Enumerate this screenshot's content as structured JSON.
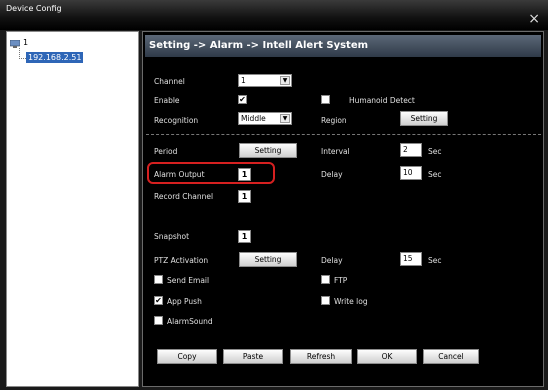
{
  "window": {
    "title": "Device Config",
    "close_glyph": "×"
  },
  "tree": {
    "root_label": "1",
    "device_ip": "192.168.2.51"
  },
  "header": {
    "breadcrumb": "Setting -> Alarm -> Intell Alert System"
  },
  "form": {
    "channel_label": "Channel",
    "channel_value": "1",
    "enable_label": "Enable",
    "enable_checked": "✔",
    "humanoid_label": "Humanoid Detect",
    "recognition_label": "Recognition",
    "recognition_value": "Middle",
    "region_label": "Region",
    "region_button": "Setting",
    "period_label": "Period",
    "period_button": "Setting",
    "interval_label": "Interval",
    "interval_value": "2",
    "interval_unit": "Sec",
    "alarm_output_label": "Alarm Output",
    "alarm_output_value": "1",
    "delay_label": "Delay",
    "delay_value": "10",
    "delay_unit": "Sec",
    "record_channel_label": "Record Channel",
    "record_channel_value": "1",
    "snapshot_label": "Snapshot",
    "snapshot_value": "1",
    "ptz_label": "PTZ Activation",
    "ptz_button": "Setting",
    "ptz_delay_label": "Delay",
    "ptz_delay_value": "15",
    "ptz_delay_unit": "Sec",
    "send_email_label": "Send Email",
    "ftp_label": "FTP",
    "app_push_label": "App Push",
    "app_push_checked": "✔",
    "write_log_label": "Write log",
    "alarm_sound_label": "AlarmSound"
  },
  "buttons": {
    "copy": "Copy",
    "paste": "Paste",
    "refresh": "Refresh",
    "ok": "OK",
    "cancel": "Cancel"
  },
  "colors": {
    "highlight": "#d62020",
    "selected_node": "#2e66b7"
  }
}
